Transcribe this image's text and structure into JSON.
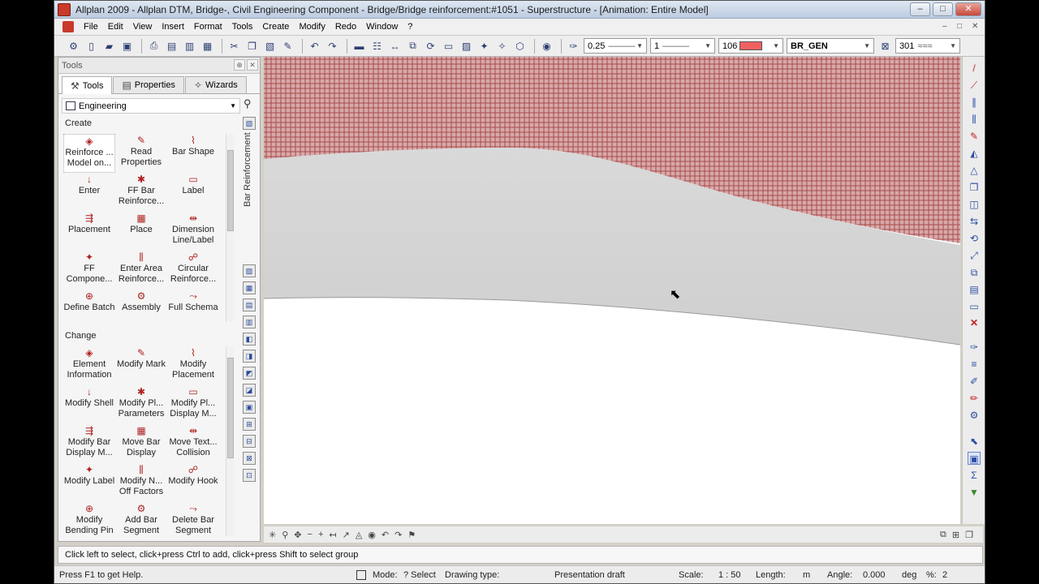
{
  "window": {
    "title": "Allplan 2009 - Allplan DTM, Bridge-, Civil Engineering Component - Bridge/Bridge reinforcement:#1051 - Superstructure - [Animation: Entire Model]",
    "controls": [
      "–",
      "□",
      "✕"
    ]
  },
  "menu": {
    "items": [
      "File",
      "Edit",
      "View",
      "Insert",
      "Format",
      "Tools",
      "Create",
      "Modify",
      "Redo",
      "Window",
      "?"
    ],
    "right_buttons": [
      "–",
      "□",
      "✕"
    ]
  },
  "toolbar": {
    "pen_value": "0.25",
    "line_value": "1",
    "color_value": "106",
    "color_hex": "#f06060",
    "layer_value": "BR_GEN",
    "pattern_value": "301"
  },
  "panel": {
    "title": "Tools",
    "tabs": [
      "Tools",
      "Properties",
      "Wizards"
    ],
    "category": "Engineering",
    "vertical_label": "Bar Reinforcement",
    "create_title": "Create",
    "create_tools": [
      {
        "label": "Reinforce ... Model on...",
        "icon": "reinforce-model-icon"
      },
      {
        "label": "Read Properties",
        "icon": "read-properties-icon"
      },
      {
        "label": "Bar Shape",
        "icon": "bar-shape-icon"
      },
      {
        "label": "Enter",
        "icon": "enter-icon"
      },
      {
        "label": "FF Bar Reinforce...",
        "icon": "ff-bar-icon"
      },
      {
        "label": "Label",
        "icon": "label-icon"
      },
      {
        "label": "Placement",
        "icon": "placement-icon"
      },
      {
        "label": "Place",
        "icon": "place-icon"
      },
      {
        "label": "Dimension Line/Label",
        "icon": "dimension-icon"
      },
      {
        "label": "FF Compone...",
        "icon": "ff-component-icon"
      },
      {
        "label": "Enter Area Reinforce...",
        "icon": "area-reinforce-icon"
      },
      {
        "label": "Circular Reinforce...",
        "icon": "circular-reinforce-icon"
      },
      {
        "label": "Define Batch",
        "icon": "define-batch-icon"
      },
      {
        "label": "Assembly",
        "icon": "assembly-icon"
      },
      {
        "label": "Full Schema",
        "icon": "full-schema-icon"
      }
    ],
    "change_title": "Change",
    "change_tools": [
      {
        "label": "Element Information",
        "icon": "element-info-icon"
      },
      {
        "label": "Modify Mark",
        "icon": "modify-mark-icon"
      },
      {
        "label": "Modify Placement",
        "icon": "modify-placement-icon"
      },
      {
        "label": "Modify Shell",
        "icon": "modify-shell-icon"
      },
      {
        "label": "Modify Pl... Parameters",
        "icon": "modify-parameters-icon"
      },
      {
        "label": "Modify Pl... Display M...",
        "icon": "modify-display-icon"
      },
      {
        "label": "Modify Bar Display M...",
        "icon": "modify-bar-display-icon"
      },
      {
        "label": "Move Bar Display",
        "icon": "move-bar-display-icon"
      },
      {
        "label": "Move Text... Collision",
        "icon": "move-text-icon"
      },
      {
        "label": "Modify Label",
        "icon": "modify-label-icon"
      },
      {
        "label": "Modify N... Off Factors",
        "icon": "modify-factors-icon"
      },
      {
        "label": "Modify Hook",
        "icon": "modify-hook-icon"
      },
      {
        "label": "Modify Bending Pin",
        "icon": "modify-pin-icon"
      },
      {
        "label": "Add Bar Segment",
        "icon": "add-segment-icon"
      },
      {
        "label": "Delete Bar Segment",
        "icon": "delete-segment-icon"
      }
    ]
  },
  "prompt": "Click left to select, click+press Ctrl to add, click+press Shift to select group",
  "status": {
    "help": "Press F1 to get Help.",
    "mode_label": "Mode:",
    "mode_value": "? Select",
    "drawing_type_label": "Drawing type:",
    "drawing_type_value": "Presentation draft",
    "scale_label": "Scale:",
    "scale_value": "1 : 50",
    "length_label": "Length:",
    "length_value": "m",
    "angle_label": "Angle:",
    "angle_value": "0.000",
    "angle_unit": "deg",
    "percent_label": "%:",
    "percent_value": "2"
  }
}
